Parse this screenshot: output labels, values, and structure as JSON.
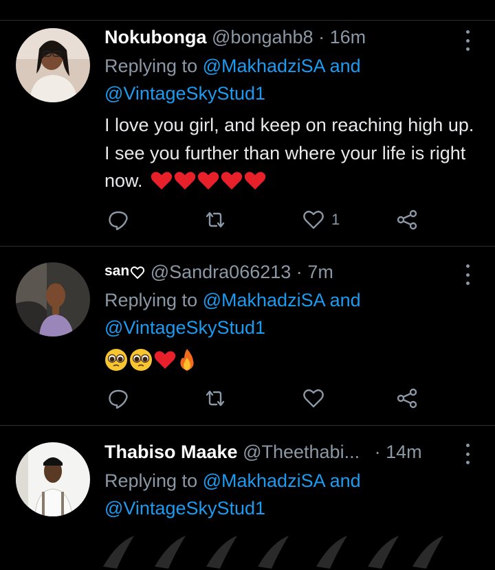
{
  "tweets": [
    {
      "name": "Nokubonga",
      "handle": "@bongahb8",
      "time": "16m",
      "replying_to": "Replying to",
      "mention1": "@MakhadziSA",
      "and": "and",
      "mention2": "@VintageSkyStud1",
      "text": "I love you girl, and keep on reaching high up. I see you further than where your life is right now.",
      "emojis": [
        "red-heart",
        "red-heart",
        "red-heart",
        "red-heart",
        "red-heart"
      ],
      "likes": "1"
    },
    {
      "name": "san",
      "name_icon": "heart-outline-icon",
      "handle": "@Sandra066213",
      "time": "7m",
      "replying_to": "Replying to",
      "mention1": "@MakhadziSA",
      "and": "and",
      "mention2": "@VintageSkyStud1",
      "emojis": [
        "pleading-face",
        "pleading-face",
        "red-heart",
        "fire"
      ],
      "likes": ""
    },
    {
      "name": "Thabiso Maake",
      "handle": "@Theethabi...",
      "time": "14m",
      "replying_to": "Replying to",
      "mention1": "@MakhadziSA",
      "and": "and",
      "mention2": "@VintageSkyStud1"
    }
  ],
  "colors": {
    "background": "#000000",
    "text": "#e7e9ea",
    "muted": "#8b98a5",
    "link": "#1d9bf0",
    "heart": "#e8202a"
  },
  "icons": {
    "reply": "reply-bubble-icon",
    "retweet": "retweet-icon",
    "like": "heart-outline-icon",
    "share": "share-icon",
    "more": "more-vertical-icon"
  }
}
